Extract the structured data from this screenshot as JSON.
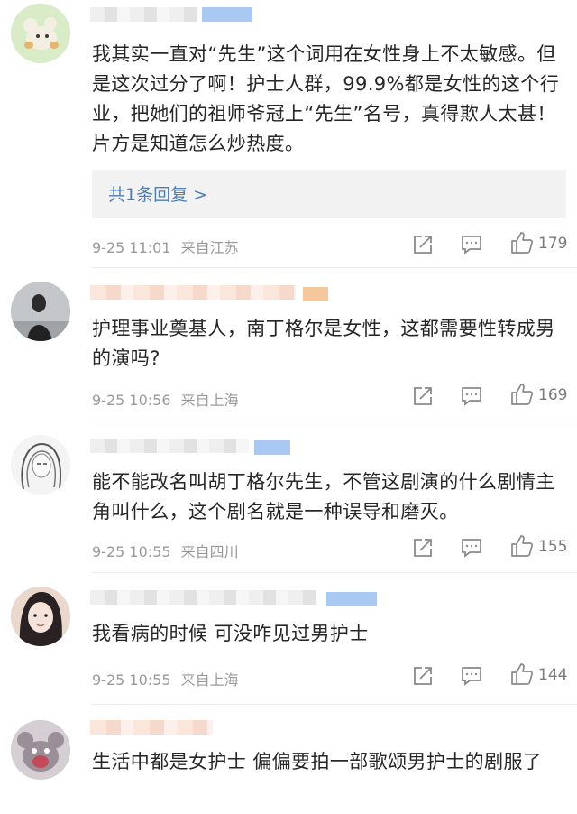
{
  "comments": [
    {
      "text": "我其实一直对“先生”这个词用在女性身上不太敏感。但是这次过分了啊！护士人群，99.9%都是女性的这个行业，把她们的祖师爷冠上“先生”名号，真得欺人太甚！片方是知道怎么炒热度。",
      "reply": "共1条回复 >",
      "date": "9-25 11:01",
      "location": "来自江苏",
      "likes": "179"
    },
    {
      "text": "护理事业奠基人，南丁格尔是女性，这都需要性转成男的演吗?",
      "date": "9-25 10:56",
      "location": "来自上海",
      "likes": "169"
    },
    {
      "text": "能不能改名叫胡丁格尔先生，不管这剧演的什么剧情主角叫什么，这个剧名就是一种误导和磨灭。",
      "date": "9-25 10:55",
      "location": "来自四川",
      "likes": "155"
    },
    {
      "text": "我看病的时候 可没咋见过男护士",
      "date": "9-25 10:55",
      "location": "来自上海",
      "likes": "144"
    },
    {
      "text": "生活中都是女护士 偏偏要拍一部歌颂男护士的剧服了"
    }
  ],
  "icons": {
    "share": "share-icon",
    "comment": "comment-icon",
    "like": "thumbs-up-icon"
  },
  "colors": {
    "link": "#4e7fb4",
    "meta": "#9a9a9a",
    "reply_bg": "#f2f2f2"
  }
}
